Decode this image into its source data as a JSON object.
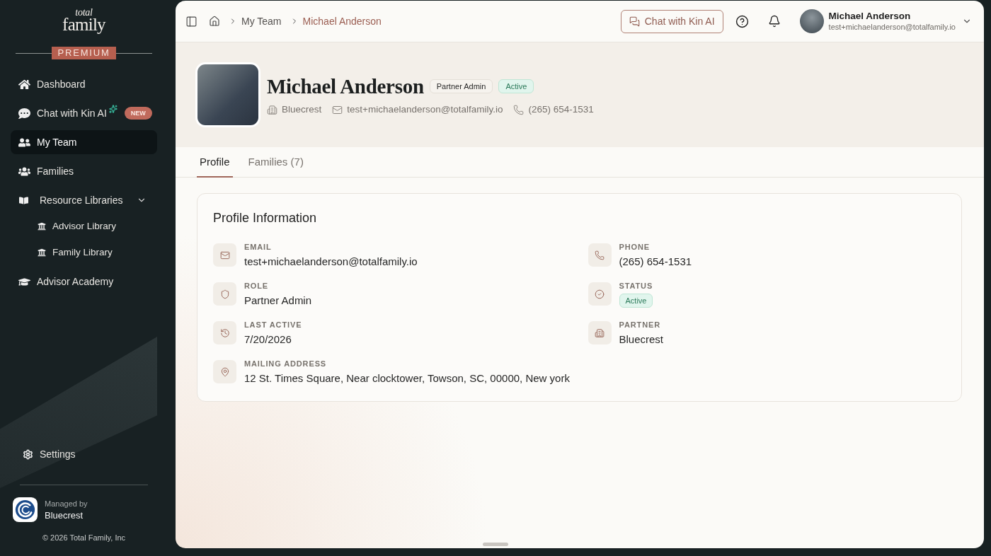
{
  "sidebar": {
    "logo": {
      "line_1": "total",
      "line_2": "family"
    },
    "tier_badge": "PREMIUM",
    "nav": [
      {
        "kind": "dashboard",
        "label": "Dashboard",
        "selected": false
      },
      {
        "kind": "chat",
        "label": "Chat with Kin AI",
        "selected": false,
        "badge": "NEW"
      },
      {
        "kind": "team",
        "label": "My Team",
        "selected": true
      },
      {
        "kind": "families",
        "label": "Families",
        "selected": false
      },
      {
        "kind": "library",
        "label": "Resource Libraries",
        "selected": false,
        "expanded": true,
        "children": [
          {
            "label": "Advisor Library",
            "selected": false
          },
          {
            "label": "Family Library",
            "selected": false
          }
        ]
      },
      {
        "kind": "academy",
        "label": "Advisor Academy",
        "selected": false
      }
    ],
    "settings": {
      "label": "Settings",
      "selected": false
    },
    "managed_by": {
      "caption": "Managed by",
      "name": "Bluecrest"
    },
    "copyright": "© 2026 Total Family, Inc"
  },
  "top_bar": {
    "breadcrumb": [
      {
        "label": "My Team",
        "current": false
      },
      {
        "label": "Michael Anderson",
        "current": true
      }
    ],
    "chat_button": "Chat with Kin AI",
    "user": {
      "name": "Michael Anderson",
      "email": "test+michaelanderson@totalfamily.io"
    }
  },
  "profile_header": {
    "name": "Michael Anderson",
    "badges": [
      {
        "kind": "role",
        "label": "Partner Admin"
      },
      {
        "kind": "status",
        "label": "Active"
      }
    ],
    "details": [
      {
        "kind": "partner",
        "text": "Bluecrest"
      },
      {
        "kind": "email",
        "text": "test+michaelanderson@totalfamily.io"
      },
      {
        "kind": "phone",
        "text": "(265) 654-1531"
      }
    ]
  },
  "tabs": [
    {
      "label": "Profile",
      "selected": true
    },
    {
      "label": "Families (7)",
      "selected": false
    }
  ],
  "profile_information": {
    "title": "Profile Information",
    "fields": [
      {
        "kind": "email",
        "label": "EMAIL",
        "value": "test+michaelanderson@totalfamily.io"
      },
      {
        "kind": "phone",
        "label": "PHONE",
        "value": "(265) 654-1531"
      },
      {
        "kind": "role",
        "label": "ROLE",
        "value": "Partner Admin"
      },
      {
        "kind": "status",
        "label": "STATUS",
        "value": "Active"
      },
      {
        "kind": "last_active",
        "label": "LAST ACTIVE",
        "value": "7/20/2026"
      },
      {
        "kind": "partner",
        "label": "PARTNER",
        "value": "Bluecrest"
      },
      {
        "kind": "address",
        "label": "MAILING ADDRESS",
        "value": "12 St. Times Square, Near clocktower, Towson, SC, 00000, New york"
      }
    ]
  }
}
